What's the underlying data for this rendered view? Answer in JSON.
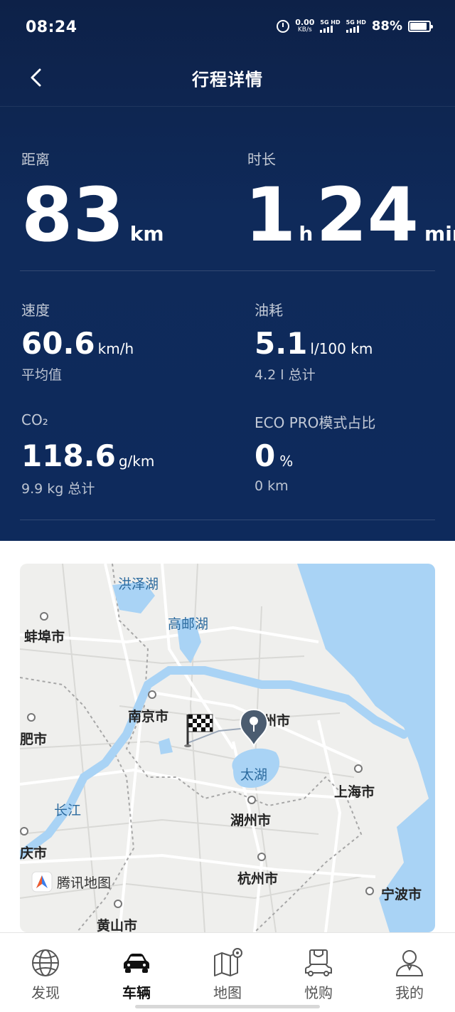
{
  "status_bar": {
    "time": "08:24",
    "net_speed_value": "0.00",
    "net_speed_unit": "KB/s",
    "sim1_label": "5G HD",
    "sim2_label": "5G HD",
    "battery_percent": "88%",
    "battery_level": 0.88
  },
  "nav": {
    "title": "行程详情"
  },
  "stats": {
    "distance": {
      "label": "距离",
      "value": "83",
      "unit": "km"
    },
    "duration": {
      "label": "时长",
      "hours": "1",
      "hours_unit": "h",
      "minutes": "24",
      "minutes_unit": "min"
    },
    "speed": {
      "label": "速度",
      "value": "60.6",
      "unit": "km/h",
      "sub": "平均值"
    },
    "fuel": {
      "label": "油耗",
      "value": "5.1",
      "unit": "l/100 km",
      "sub": "4.2 l 总计"
    },
    "co2": {
      "label": "CO₂",
      "value": "118.6",
      "unit": "g/km",
      "sub": "9.9 kg 总计"
    },
    "eco": {
      "label": "ECO PRO模式占比",
      "value": "0",
      "unit": "%",
      "sub": "0 km"
    }
  },
  "map": {
    "labels": {
      "hongze": "洪泽湖",
      "gaoyou": "高邮湖",
      "bengbu": "蚌埠市",
      "nanjing": "南京市",
      "suzhou_partial": "州市",
      "hefei_partial": "肥市",
      "taihu": "太湖",
      "shanghai": "上海市",
      "changjiang": "长江",
      "huzhou": "湖州市",
      "partial_left": "庆市",
      "hangzhou": "杭州市",
      "tencent": "腾讯地图",
      "ningbo": "宁波市",
      "huangshan": "黄山市"
    }
  },
  "tabs": [
    {
      "label": "发现",
      "icon": "globe-icon"
    },
    {
      "label": "车辆",
      "icon": "car-icon"
    },
    {
      "label": "地图",
      "icon": "map-icon"
    },
    {
      "label": "悦购",
      "icon": "shopping-car-icon"
    },
    {
      "label": "我的",
      "icon": "user-icon"
    }
  ],
  "colors": {
    "header_bg": "#0f2a5a",
    "map_water": "#a9d3f5",
    "map_land": "#efefed"
  }
}
